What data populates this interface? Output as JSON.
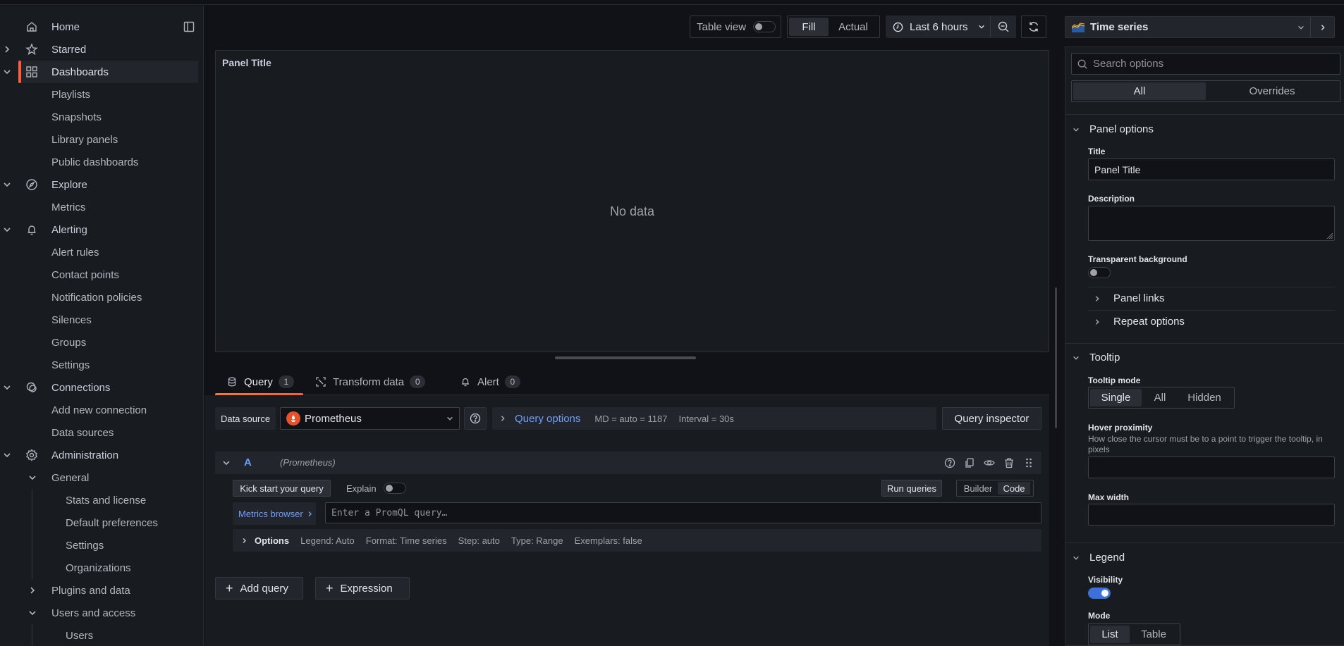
{
  "sidebar": {
    "items": [
      {
        "label": "Home",
        "icon": "home-icon"
      },
      {
        "label": "Starred",
        "icon": "star-icon"
      },
      {
        "label": "Dashboards",
        "icon": "dashboards-grid-icon",
        "active": true
      },
      {
        "label": "Playlists"
      },
      {
        "label": "Snapshots"
      },
      {
        "label": "Library panels"
      },
      {
        "label": "Public dashboards"
      },
      {
        "label": "Explore",
        "icon": "compass-icon"
      },
      {
        "label": "Metrics"
      },
      {
        "label": "Alerting",
        "icon": "bell-icon"
      },
      {
        "label": "Alert rules"
      },
      {
        "label": "Contact points"
      },
      {
        "label": "Notification policies"
      },
      {
        "label": "Silences"
      },
      {
        "label": "Groups"
      },
      {
        "label": "Settings"
      },
      {
        "label": "Connections",
        "icon": "connections-icon"
      },
      {
        "label": "Add new connection"
      },
      {
        "label": "Data sources"
      },
      {
        "label": "Administration",
        "icon": "gear-icon"
      },
      {
        "label": "General"
      },
      {
        "label": "Stats and license"
      },
      {
        "label": "Default preferences"
      },
      {
        "label": "Settings"
      },
      {
        "label": "Organizations"
      },
      {
        "label": "Plugins and data"
      },
      {
        "label": "Users and access"
      },
      {
        "label": "Users"
      }
    ]
  },
  "toolbar": {
    "table_view_label": "Table view",
    "table_view_on": false,
    "fill_label": "Fill",
    "actual_label": "Actual",
    "selected_size_mode": "Fill",
    "time_range": "Last 6 hours"
  },
  "panel": {
    "title": "Panel Title",
    "empty_text": "No data"
  },
  "tabs": [
    {
      "label": "Query",
      "count": "1",
      "active": true
    },
    {
      "label": "Transform data",
      "count": "0"
    },
    {
      "label": "Alert",
      "count": "0"
    }
  ],
  "query_editor": {
    "data_source_label": "Data source",
    "data_source": "Prometheus",
    "query_options_label": "Query options",
    "md_info": "MD = auto = 1187",
    "interval_info": "Interval = 30s",
    "query_inspector_label": "Query inspector",
    "query": {
      "ref_id": "A",
      "datasource_hint": "(Prometheus)",
      "kick_start_label": "Kick start your query",
      "explain_label": "Explain",
      "explain_on": false,
      "run_queries_label": "Run queries",
      "builder_label": "Builder",
      "code_label": "Code",
      "selected_mode": "Code",
      "metrics_browser_label": "Metrics browser",
      "promql_placeholder": "Enter a PromQL query…",
      "promql_value": "",
      "options_label": "Options",
      "options_summary": [
        "Legend: Auto",
        "Format: Time series",
        "Step: auto",
        "Type: Range",
        "Exemplars: false"
      ]
    },
    "add_query_label": "Add query",
    "expression_label": "Expression"
  },
  "right_pane": {
    "visualization": "Time series",
    "search_placeholder": "Search options",
    "tabs": [
      "All",
      "Overrides"
    ],
    "selected_tab": "All",
    "panel_options": {
      "heading": "Panel options",
      "title_label": "Title",
      "title_value": "Panel Title",
      "description_label": "Description",
      "description_value": "",
      "transparent_label": "Transparent background",
      "transparent_on": false,
      "panel_links_label": "Panel links",
      "repeat_options_label": "Repeat options"
    },
    "tooltip": {
      "heading": "Tooltip",
      "mode_label": "Tooltip mode",
      "modes": [
        "Single",
        "All",
        "Hidden"
      ],
      "selected_mode": "Single",
      "hover_label": "Hover proximity",
      "hover_desc": "How close the cursor must be to a point to trigger the tooltip, in pixels",
      "hover_value": "",
      "max_width_label": "Max width",
      "max_width_value": ""
    },
    "legend": {
      "heading": "Legend",
      "visibility_label": "Visibility",
      "visibility_on": true,
      "mode_label": "Mode",
      "modes": [
        "List",
        "Table"
      ],
      "selected_mode": "List"
    }
  }
}
